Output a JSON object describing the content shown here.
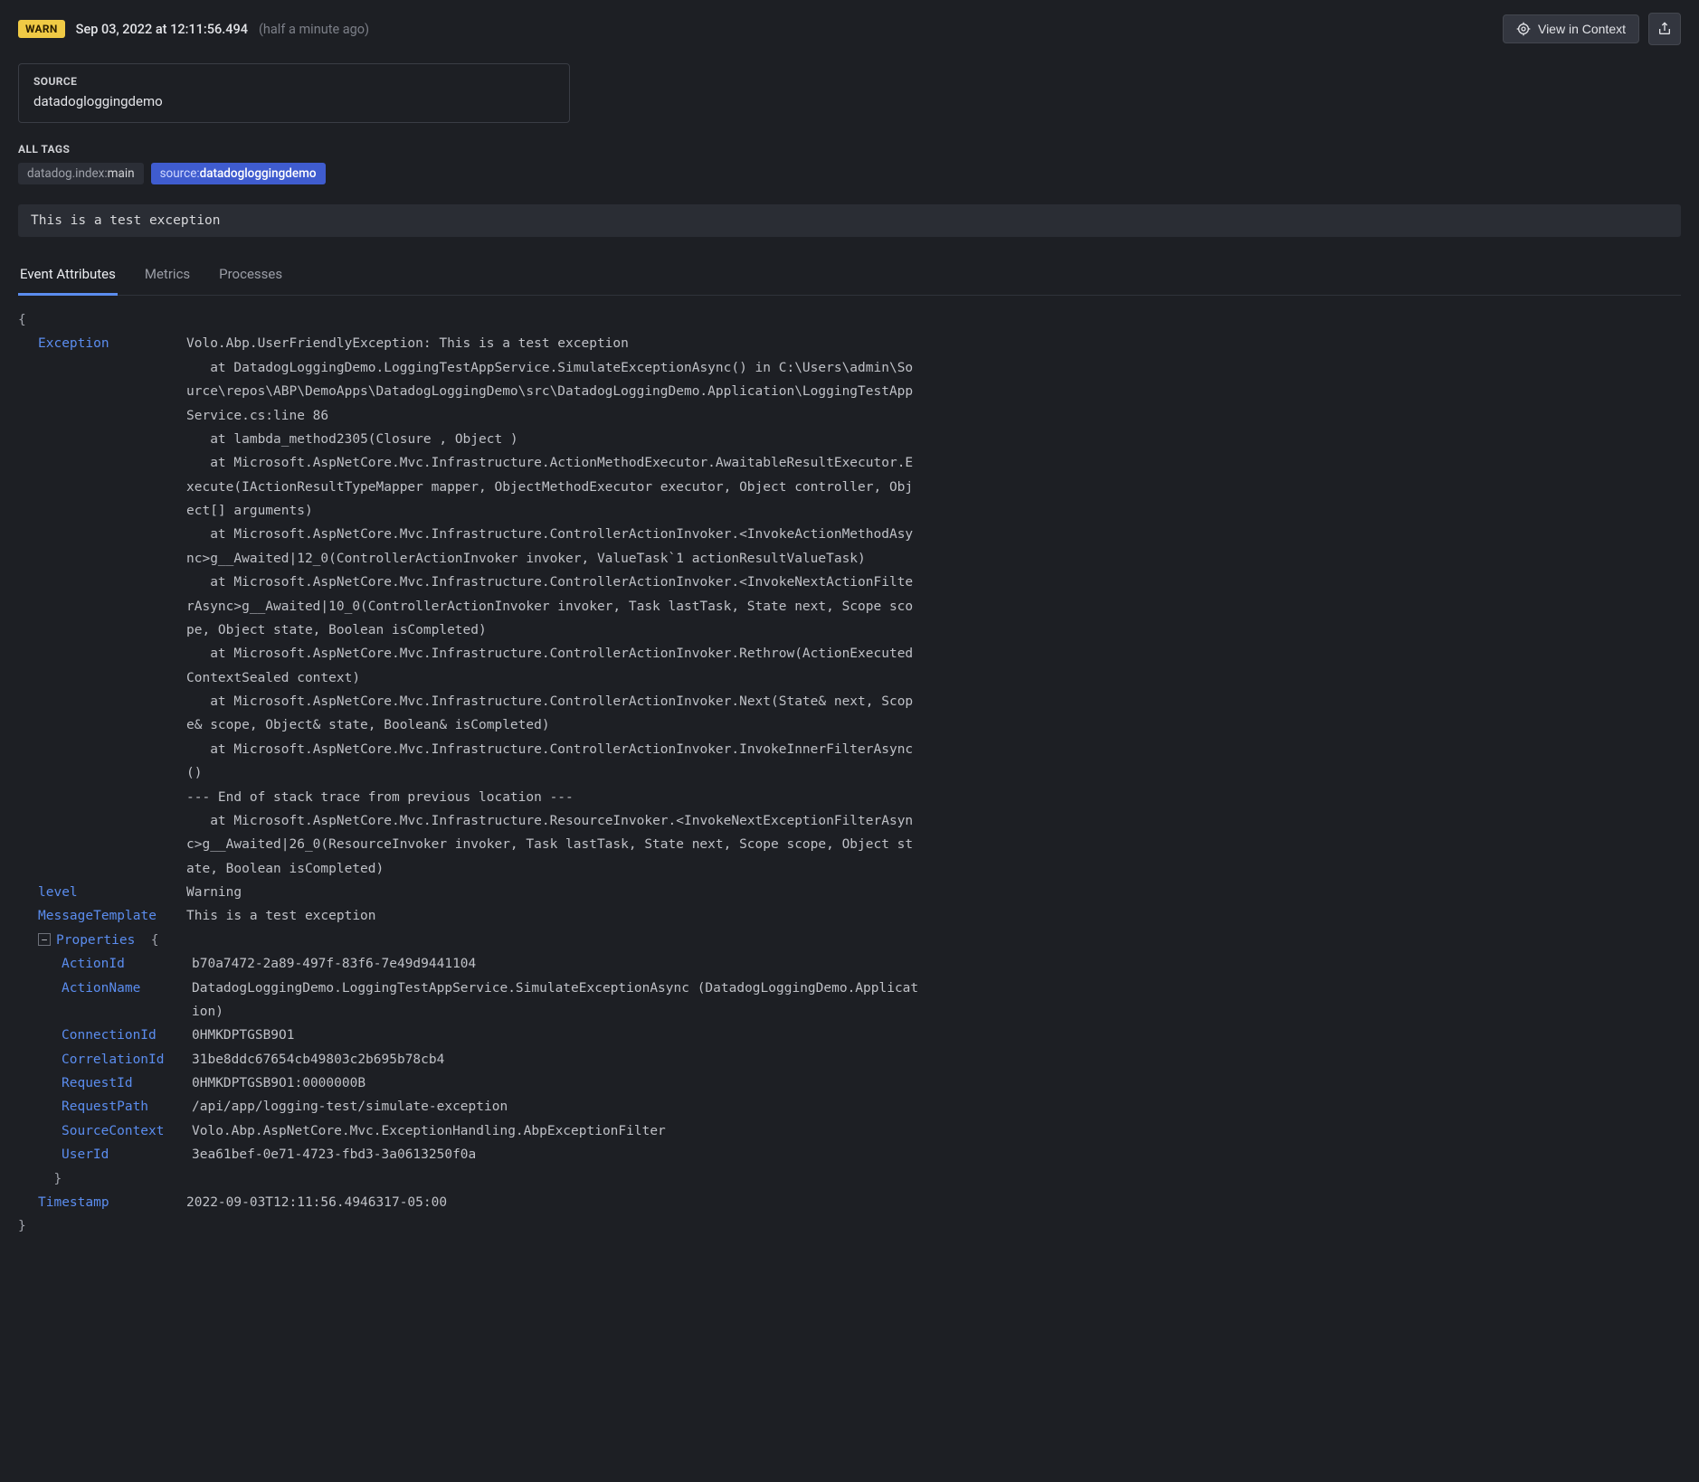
{
  "header": {
    "level_badge": "WARN",
    "timestamp": "Sep 03, 2022 at 12:11:56.494",
    "relative": "(half a minute ago)",
    "view_in_context": "View in Context"
  },
  "source_card": {
    "label": "SOURCE",
    "value": "datadogloggingdemo"
  },
  "tags_section": {
    "label": "ALL TAGS",
    "tags": [
      {
        "key": "datadog.index:",
        "value": "main",
        "highlight": false
      },
      {
        "key": "source:",
        "value": "datadogloggingdemo",
        "highlight": true
      }
    ]
  },
  "message": "This is a test exception",
  "tabs": [
    {
      "id": "event-attributes",
      "label": "Event Attributes",
      "active": true
    },
    {
      "id": "metrics",
      "label": "Metrics",
      "active": false
    },
    {
      "id": "processes",
      "label": "Processes",
      "active": false
    }
  ],
  "attributes": {
    "Exception": "Volo.Abp.UserFriendlyException: This is a test exception\n   at DatadogLoggingDemo.LoggingTestAppService.SimulateExceptionAsync() in C:\\Users\\admin\\Source\\repos\\ABP\\DemoApps\\DatadogLoggingDemo\\src\\DatadogLoggingDemo.Application\\LoggingTestAppService.cs:line 86\n   at lambda_method2305(Closure , Object )\n   at Microsoft.AspNetCore.Mvc.Infrastructure.ActionMethodExecutor.AwaitableResultExecutor.Execute(IActionResultTypeMapper mapper, ObjectMethodExecutor executor, Object controller, Object[] arguments)\n   at Microsoft.AspNetCore.Mvc.Infrastructure.ControllerActionInvoker.<InvokeActionMethodAsync>g__Awaited|12_0(ControllerActionInvoker invoker, ValueTask`1 actionResultValueTask)\n   at Microsoft.AspNetCore.Mvc.Infrastructure.ControllerActionInvoker.<InvokeNextActionFilterAsync>g__Awaited|10_0(ControllerActionInvoker invoker, Task lastTask, State next, Scope scope, Object state, Boolean isCompleted)\n   at Microsoft.AspNetCore.Mvc.Infrastructure.ControllerActionInvoker.Rethrow(ActionExecutedContextSealed context)\n   at Microsoft.AspNetCore.Mvc.Infrastructure.ControllerActionInvoker.Next(State& next, Scope& scope, Object& state, Boolean& isCompleted)\n   at Microsoft.AspNetCore.Mvc.Infrastructure.ControllerActionInvoker.InvokeInnerFilterAsync()\n--- End of stack trace from previous location ---\n   at Microsoft.AspNetCore.Mvc.Infrastructure.ResourceInvoker.<InvokeNextExceptionFilterAsync>g__Awaited|26_0(ResourceInvoker invoker, Task lastTask, State next, Scope scope, Object state, Boolean isCompleted)",
    "level": "Warning",
    "MessageTemplate": "This is a test exception",
    "Properties": {
      "ActionId": "b70a7472-2a89-497f-83f6-7e49d9441104",
      "ActionName": "DatadogLoggingDemo.LoggingTestAppService.SimulateExceptionAsync (DatadogLoggingDemo.Application)",
      "ConnectionId": "0HMKDPTGSB9O1",
      "CorrelationId": "31be8ddc67654cb49803c2b695b78cb4",
      "RequestId": "0HMKDPTGSB9O1:0000000B",
      "RequestPath": "/api/app/logging-test/simulate-exception",
      "SourceContext": "Volo.Abp.AspNetCore.Mvc.ExceptionHandling.AbpExceptionFilter",
      "UserId": "3ea61bef-0e71-4723-fbd3-3a0613250f0a"
    },
    "Timestamp": "2022-09-03T12:11:56.4946317-05:00"
  },
  "json_labels": {
    "Exception": "Exception",
    "level": "level",
    "MessageTemplate": "MessageTemplate",
    "Properties": "Properties",
    "ActionId": "ActionId",
    "ActionName": "ActionName",
    "ConnectionId": "ConnectionId",
    "CorrelationId": "CorrelationId",
    "RequestId": "RequestId",
    "RequestPath": "RequestPath",
    "SourceContext": "SourceContext",
    "UserId": "UserId",
    "Timestamp": "Timestamp"
  }
}
